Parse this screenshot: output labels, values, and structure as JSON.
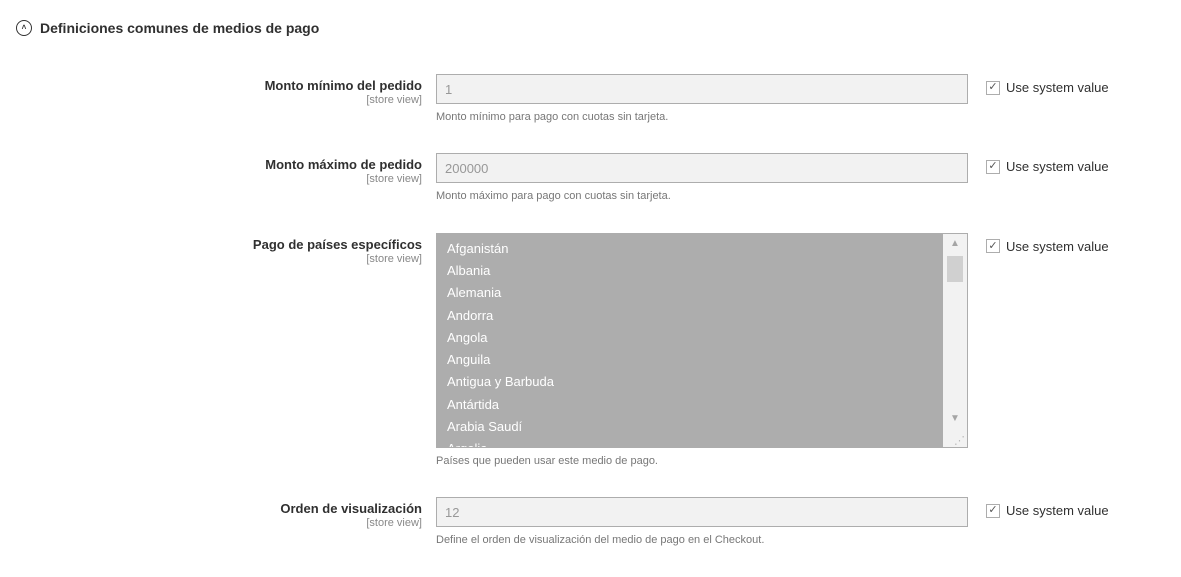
{
  "section": {
    "title": "Definiciones comunes de medios de pago"
  },
  "scope_label": "[store view]",
  "use_system_value_label": "Use system value",
  "fields": {
    "min_order": {
      "label": "Monto mínimo del pedido",
      "value": "1",
      "helper": "Monto mínimo para pago con cuotas sin tarjeta.",
      "use_system": true
    },
    "max_order": {
      "label": "Monto máximo de pedido",
      "value": "200000",
      "helper": "Monto máximo para pago con cuotas sin tarjeta.",
      "use_system": true
    },
    "specific_countries": {
      "label": "Pago de países específicos",
      "helper": "Países que pueden usar este medio de pago.",
      "use_system": true,
      "options_visible": [
        "Afganistán",
        "Albania",
        "Alemania",
        "Andorra",
        "Angola",
        "Anguila",
        "Antigua y Barbuda",
        "Antártida",
        "Arabia Saudí",
        "Argelia"
      ]
    },
    "sort_order": {
      "label": "Orden de visualización",
      "value": "12",
      "helper": "Define el orden de visualización del medio de pago en el Checkout.",
      "use_system": true
    }
  }
}
